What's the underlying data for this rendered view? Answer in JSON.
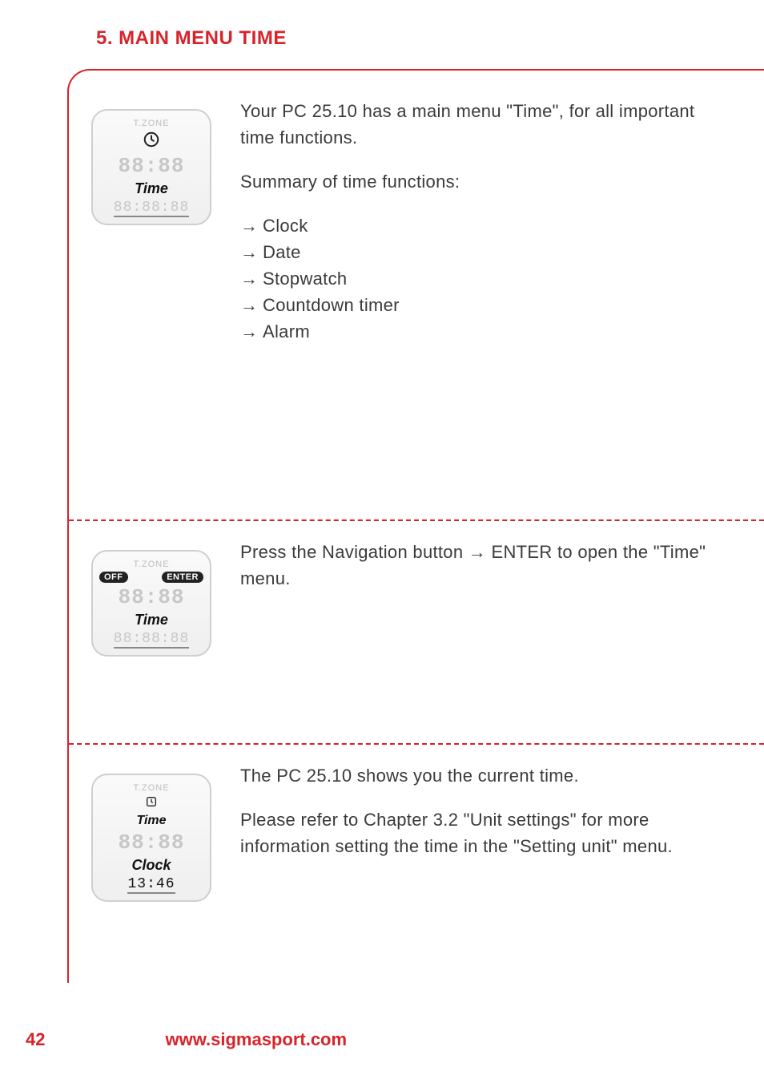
{
  "section_title": "5. MAIN MENU TIME",
  "block1": {
    "screen": {
      "zone": "T.ZONE",
      "seg": "88:88",
      "label": "Time",
      "bottom": "88:88:88"
    },
    "intro": "Your PC 25.10 has a main menu \"Time\", for all important time functions.",
    "summary_head": "Summary of time functions:",
    "items": [
      "Clock",
      "Date",
      "Stopwatch",
      "Countdown timer",
      "Alarm"
    ]
  },
  "block2": {
    "screen": {
      "zone": "T.ZONE",
      "pill_left": "OFF",
      "pill_right": "ENTER",
      "seg": "88:88",
      "label": "Time",
      "bottom": "88:88:88"
    },
    "text": "Press the Navigation button → ENTER to open the \"Time\" menu."
  },
  "block3": {
    "screen": {
      "zone": "T.ZONE",
      "sub": "Time",
      "seg": "88:88",
      "label": "Clock",
      "bottom": "13:46"
    },
    "line1": "The PC 25.10 shows you the current time.",
    "line2": "Please refer to Chapter 3.2 \"Unit settings\" for more information setting the time in the \"Setting unit\" menu."
  },
  "footer": {
    "page": "42",
    "url": "www.sigmasport.com"
  }
}
